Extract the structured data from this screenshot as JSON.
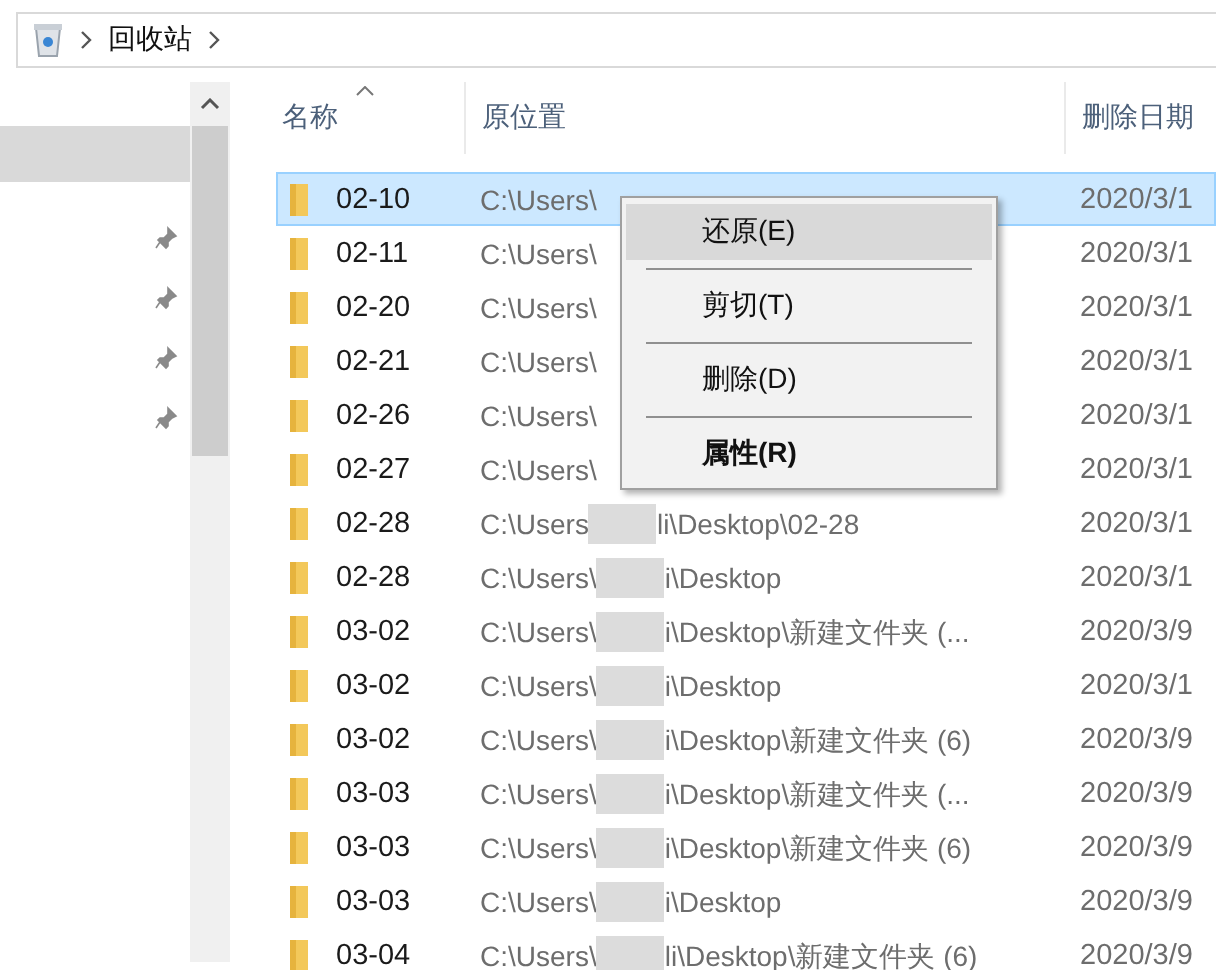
{
  "breadcrumb": {
    "items": [
      {
        "label": "回收站"
      }
    ]
  },
  "nav": {
    "items": [
      {
        "selected": true,
        "pinned": false
      },
      {
        "selected": false,
        "pinned": true
      },
      {
        "selected": false,
        "pinned": true
      },
      {
        "selected": false,
        "pinned": true
      },
      {
        "selected": false,
        "pinned": true
      }
    ]
  },
  "table": {
    "columns": [
      {
        "label": "名称",
        "sorted": true
      },
      {
        "label": "原位置",
        "sorted": false
      },
      {
        "label": "删除日期",
        "sorted": false
      }
    ],
    "rows": [
      {
        "name": "02-10",
        "location": "C:\\Users\\",
        "location_rest": "",
        "date": "2020/3/1",
        "selected": true
      },
      {
        "name": "02-11",
        "location": "C:\\Users\\",
        "location_rest": "",
        "date": "2020/3/1",
        "selected": false
      },
      {
        "name": "02-20",
        "location": "C:\\Users\\",
        "location_rest": "",
        "date": "2020/3/1",
        "selected": false
      },
      {
        "name": "02-21",
        "location": "C:\\Users\\",
        "location_rest": "",
        "date": "2020/3/1",
        "selected": false
      },
      {
        "name": "02-26",
        "location": "C:\\Users\\",
        "location_rest": "",
        "date": "2020/3/1",
        "selected": false
      },
      {
        "name": "02-27",
        "location": "C:\\Users\\",
        "location_rest": "",
        "date": "2020/3/1",
        "selected": false
      },
      {
        "name": "02-28",
        "location": "C:\\Users",
        "location_rest": "li\\Desktop\\02-28",
        "date": "2020/3/1",
        "selected": false
      },
      {
        "name": "02-28",
        "location": "C:\\Users\\",
        "location_rest": "i\\Desktop",
        "date": "2020/3/1",
        "selected": false
      },
      {
        "name": "03-02",
        "location": "C:\\Users\\",
        "location_rest": "i\\Desktop\\新建文件夹 (...",
        "date": "2020/3/9",
        "selected": false
      },
      {
        "name": "03-02",
        "location": "C:\\Users\\",
        "location_rest": "i\\Desktop",
        "date": "2020/3/1",
        "selected": false
      },
      {
        "name": "03-02",
        "location": "C:\\Users\\",
        "location_rest": "i\\Desktop\\新建文件夹 (6)",
        "date": "2020/3/9",
        "selected": false
      },
      {
        "name": "03-03",
        "location": "C:\\Users\\",
        "location_rest": "i\\Desktop\\新建文件夹 (...",
        "date": "2020/3/9",
        "selected": false
      },
      {
        "name": "03-03",
        "location": "C:\\Users\\",
        "location_rest": "i\\Desktop\\新建文件夹 (6)",
        "date": "2020/3/9",
        "selected": false
      },
      {
        "name": "03-03",
        "location": "C:\\Users\\",
        "location_rest": "i\\Desktop",
        "date": "2020/3/9",
        "selected": false
      },
      {
        "name": "03-04",
        "location": "C:\\Users\\",
        "location_rest": "li\\Desktop\\新建文件夹 (6)",
        "date": "2020/3/9",
        "selected": false
      }
    ]
  },
  "context_menu": {
    "items": [
      {
        "label": "还原(E)",
        "highlighted": true,
        "bold": false
      },
      {
        "label": "剪切(T)",
        "highlighted": false,
        "bold": false
      },
      {
        "label": "删除(D)",
        "highlighted": false,
        "bold": false
      },
      {
        "label": "属性(R)",
        "highlighted": false,
        "bold": true
      }
    ]
  }
}
